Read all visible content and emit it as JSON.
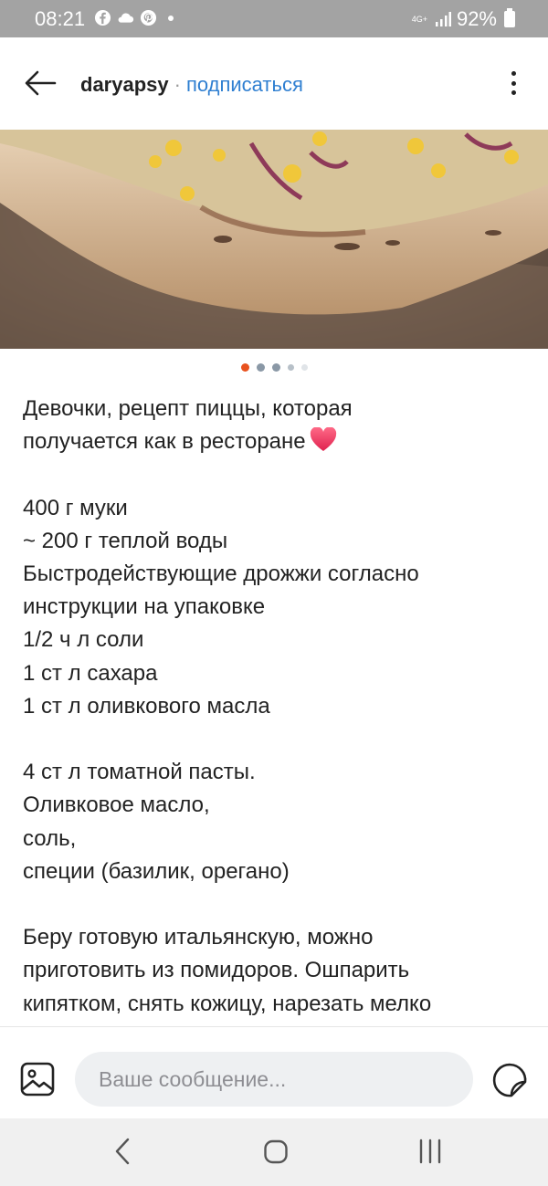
{
  "status_bar": {
    "time": "08:21",
    "network": "4G+",
    "battery": "92%",
    "icons": [
      "facebook-icon",
      "cloud-icon",
      "pinterest-icon",
      "dot-icon",
      "signal-icon",
      "battery-icon"
    ]
  },
  "header": {
    "username": "daryapsy",
    "separator": "·",
    "subscribe_label": "подписаться",
    "back_icon": "arrow-left-icon",
    "more_icon": "more-vertical-icon"
  },
  "carousel": {
    "total": 5,
    "active_index": 0
  },
  "post": {
    "paragraphs": [
      [
        "Девочки, рецепт пиццы, которая",
        "получается как в ресторане"
      ],
      [
        "400 г муки",
        "~ 200 г теплой воды",
        "Быстродействующие дрожжи согласно",
        "инструкции на упаковке",
        "1/2 ч л соли",
        "1 ст л сахара",
        "1 ст л оливкового масла"
      ],
      [
        "4 ст л томатной пасты.",
        "Оливковое масло,",
        "соль,",
        "специи (базилик, орегано)"
      ],
      [
        "Беру готовую итальянскую, можно",
        "приготовить из помидоров. Ошпарить",
        "кипятком, снять кожицу, нарезать мелко"
      ]
    ]
  },
  "composer": {
    "placeholder": "Ваше сообщение...",
    "gallery_icon": "image-icon",
    "sticker_icon": "sticker-icon"
  },
  "navbar": {
    "icons": [
      "back-nav-icon",
      "home-nav-icon",
      "recents-nav-icon"
    ]
  },
  "colors": {
    "accent": "#2f7fd1",
    "active_dot": "#e8521f",
    "status_bar": "#a3a3a3",
    "heart": "#e8365d"
  }
}
